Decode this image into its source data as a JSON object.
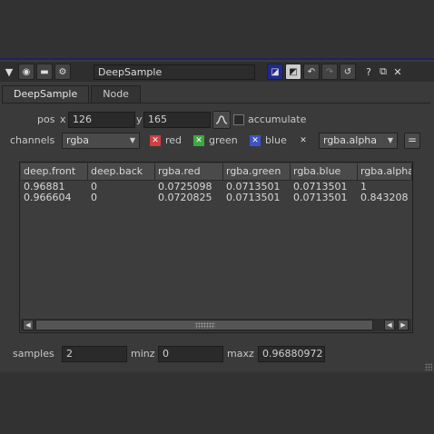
{
  "window": {
    "title": "DeepSample",
    "buttons": {
      "help": "?",
      "float": "⧉",
      "close": "✕"
    }
  },
  "tabs": [
    {
      "label": "DeepSample",
      "active": true
    },
    {
      "label": "Node",
      "active": false
    }
  ],
  "pos": {
    "label": "pos",
    "x_label": "x",
    "x_value": "126",
    "y_label": "y",
    "y_value": "165",
    "accumulate_label": "accumulate",
    "accumulate_checked": false
  },
  "channels": {
    "label": "channels",
    "selected": "rgba",
    "red_label": "red",
    "green_label": "green",
    "blue_label": "blue",
    "red_color": "#d04040",
    "green_color": "#3fa83f",
    "blue_color": "#3b55c8",
    "alpha_selected": "rgba.alpha",
    "link_label": "="
  },
  "table": {
    "headers": [
      "deep.front",
      "deep.back",
      "rgba.red",
      "rgba.green",
      "rgba.blue",
      "rgba.alpha"
    ],
    "rows": [
      [
        "0.96881",
        "0",
        "0.0725098",
        "0.0713501",
        "0.0713501",
        "1"
      ],
      [
        "0.966604",
        "0",
        "0.0720825",
        "0.0713501",
        "0.0713501",
        "0.843208"
      ]
    ]
  },
  "footer": {
    "samples_label": "samples",
    "samples_value": "2",
    "minz_label": "minz",
    "minz_value": "0",
    "maxz_label": "maxz",
    "maxz_value": "0.96880972"
  }
}
